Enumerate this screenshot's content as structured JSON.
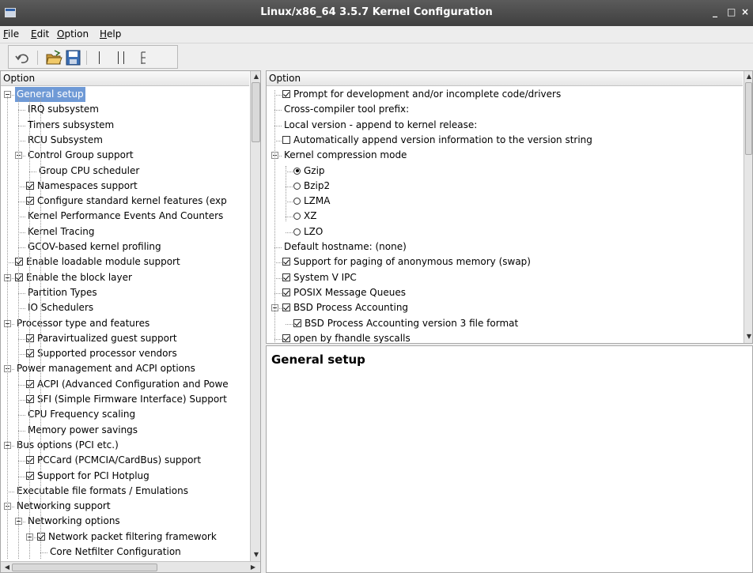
{
  "window": {
    "title": "Linux/x86_64 3.5.7 Kernel Configuration",
    "minimize_glyph": "_",
    "maximize_glyph": "□",
    "close_glyph": "×"
  },
  "menu": [
    {
      "label": "File",
      "mnemonic": "F",
      "rest": "ile"
    },
    {
      "label": "Edit",
      "mnemonic": "E",
      "rest": "dit"
    },
    {
      "label": "Option",
      "mnemonic": "O",
      "rest": "ption"
    },
    {
      "label": "Help",
      "mnemonic": "H",
      "rest": "elp"
    }
  ],
  "toolbar": {
    "icons": [
      "undo-icon",
      "open-folder-icon",
      "save-icon",
      "single-view-icon",
      "split-view-icon",
      "full-view-icon"
    ]
  },
  "left_pane": {
    "header": "Option",
    "rows": [
      {
        "label": "General setup",
        "selected": true
      },
      {
        "label": "IRQ subsystem"
      },
      {
        "label": "Timers subsystem"
      },
      {
        "label": "RCU Subsystem"
      },
      {
        "label": "Control Group support"
      },
      {
        "label": "Group CPU scheduler"
      },
      {
        "label": "Namespaces support",
        "check": true
      },
      {
        "label": "Configure standard kernel features (exp",
        "check": true
      },
      {
        "label": "Kernel Performance Events And Counters"
      },
      {
        "label": "Kernel Tracing"
      },
      {
        "label": "GCOV-based kernel profiling"
      },
      {
        "label": "Enable loadable module support",
        "check": true
      },
      {
        "label": "Enable the block layer",
        "check": true
      },
      {
        "label": "Partition Types"
      },
      {
        "label": "IO Schedulers"
      },
      {
        "label": "Processor type and features"
      },
      {
        "label": "Paravirtualized guest support",
        "check": true
      },
      {
        "label": "Supported processor vendors",
        "check": true
      },
      {
        "label": "Power management and ACPI options"
      },
      {
        "label": "ACPI (Advanced Configuration and Powe",
        "check": true
      },
      {
        "label": "SFI (Simple Firmware Interface) Support",
        "check": true
      },
      {
        "label": "CPU Frequency scaling"
      },
      {
        "label": "Memory power savings"
      },
      {
        "label": "Bus options (PCI etc.)"
      },
      {
        "label": "PCCard (PCMCIA/CardBus) support",
        "check": true
      },
      {
        "label": "Support for PCI Hotplug",
        "check": true
      },
      {
        "label": "Executable file formats / Emulations"
      },
      {
        "label": "Networking support"
      },
      {
        "label": "Networking options"
      },
      {
        "label": "Network packet filtering framework",
        "check": true
      },
      {
        "label": "Core Netfilter Configuration"
      }
    ]
  },
  "right_pane": {
    "header": "Option",
    "rows": [
      {
        "label": "Prompt for development and/or incomplete code/drivers",
        "check": true
      },
      {
        "label": "Cross-compiler tool prefix:"
      },
      {
        "label": "Local version - append to kernel release:"
      },
      {
        "label": "Automatically append version information to the version string",
        "check": false
      },
      {
        "label": "Kernel compression mode"
      },
      {
        "label": "Gzip",
        "radio": true
      },
      {
        "label": "Bzip2",
        "radio": false
      },
      {
        "label": "LZMA",
        "radio": false
      },
      {
        "label": "XZ",
        "radio": false
      },
      {
        "label": "LZO",
        "radio": false
      },
      {
        "label": "Default hostname: (none)"
      },
      {
        "label": "Support for paging of anonymous memory (swap)",
        "check": true
      },
      {
        "label": "System V IPC",
        "check": true
      },
      {
        "label": "POSIX Message Queues",
        "check": true
      },
      {
        "label": "BSD Process Accounting",
        "check": true
      },
      {
        "label": "BSD Process Accounting version 3 file format",
        "check": true
      },
      {
        "label": "open by fhandle syscalls",
        "check": true
      }
    ]
  },
  "help_pane": {
    "title": "General setup"
  }
}
